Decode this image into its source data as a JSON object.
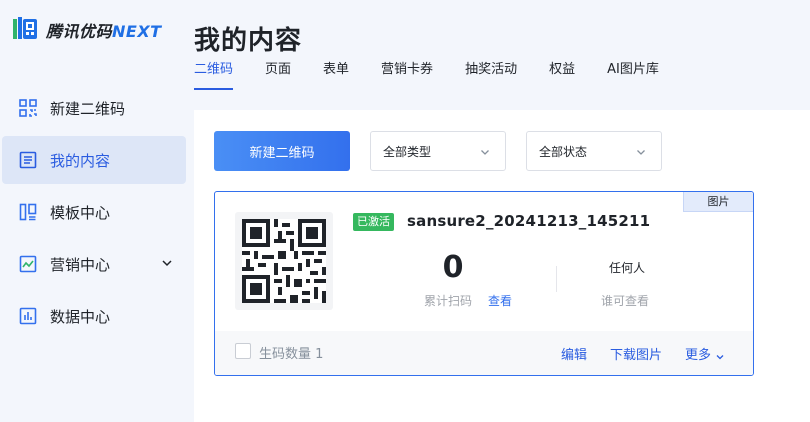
{
  "app": {
    "logo_text": "腾讯优码",
    "logo_suffix": "NEXT"
  },
  "sidebar": {
    "items": [
      {
        "label": "新建二维码",
        "icon": "qr-grid-icon",
        "active": false
      },
      {
        "label": "我的内容",
        "icon": "document-list-icon",
        "active": true
      },
      {
        "label": "模板中心",
        "icon": "template-icon",
        "active": false
      },
      {
        "label": "营销中心",
        "icon": "chart-area-icon",
        "active": false,
        "expandable": true
      },
      {
        "label": "数据中心",
        "icon": "bar-chart-icon",
        "active": false
      }
    ]
  },
  "header": {
    "title": "我的内容",
    "tabs": [
      {
        "label": "二维码",
        "active": true
      },
      {
        "label": "页面",
        "active": false
      },
      {
        "label": "表单",
        "active": false
      },
      {
        "label": "营销卡券",
        "active": false
      },
      {
        "label": "抽奖活动",
        "active": false
      },
      {
        "label": "权益",
        "active": false
      },
      {
        "label": "AI图片库",
        "active": false
      }
    ]
  },
  "toolbar": {
    "new_button": "新建二维码",
    "type_select": "全部类型",
    "status_select": "全部状态"
  },
  "card": {
    "badge": "图片",
    "status": "已激活",
    "name": "sansure2_20241213_145211",
    "scan_count": "0",
    "scan_label": "累计扫码",
    "view_link": "查看",
    "permission_value": "任何人",
    "permission_label": "谁可查看",
    "footer": {
      "generate_label": "生码数量 1",
      "edit": "编辑",
      "download": "下载图片",
      "more": "更多"
    }
  },
  "colors": {
    "accent": "#3370ed",
    "active_bg": "#dde6f7",
    "status_green": "#35b85e",
    "sidebar_bg": "#f3f6fc"
  }
}
